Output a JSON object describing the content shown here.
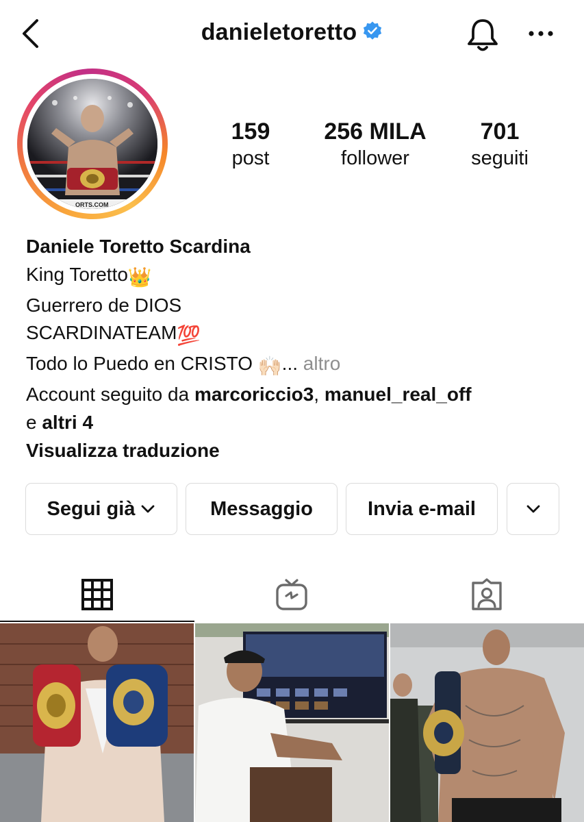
{
  "header": {
    "username": "danieletoretto",
    "verified_icon": "verified-badge-icon",
    "back_icon": "chevron-left-icon",
    "bell_icon": "bell-icon",
    "more_icon": "ellipsis-icon"
  },
  "profile": {
    "avatar_icon": "story-ring-avatar",
    "stats": [
      {
        "value": "159",
        "label": "post"
      },
      {
        "value": "256 MILA",
        "label": "follower"
      },
      {
        "value": "701",
        "label": "seguiti"
      }
    ]
  },
  "bio": {
    "full_name": "Daniele Toretto Scardina",
    "line1": "King Toretto",
    "line1_emoji": "👑",
    "line2": "Guerrero de DIOS",
    "line3": "SCARDINATEAM",
    "line3_emoji": "💯",
    "line4": "Todo lo Puedo en CRISTO ",
    "line4_emoji": "🙌🏻",
    "ellipsis": "...",
    "more_link": "altro",
    "followed_by_prefix": "Account seguito da ",
    "followed_user1": "marcoriccio3",
    "followed_sep": ", ",
    "followed_user2": "manuel_real_off",
    "followed_and": "e ",
    "followed_others": "altri 4",
    "translate_link": "Visualizza traduzione"
  },
  "actions": {
    "following_label": "Segui già",
    "message_label": "Messaggio",
    "email_label": "Invia e-mail",
    "suggest_icon": "chevron-down-icon"
  },
  "tabs": [
    {
      "icon": "grid-icon",
      "active": true
    },
    {
      "icon": "igtv-icon",
      "active": false
    },
    {
      "icon": "tagged-icon",
      "active": false
    }
  ],
  "colors": {
    "verified_blue": "#3897f0",
    "border": "#dbdbdb",
    "muted_text": "#8e8e8e"
  }
}
